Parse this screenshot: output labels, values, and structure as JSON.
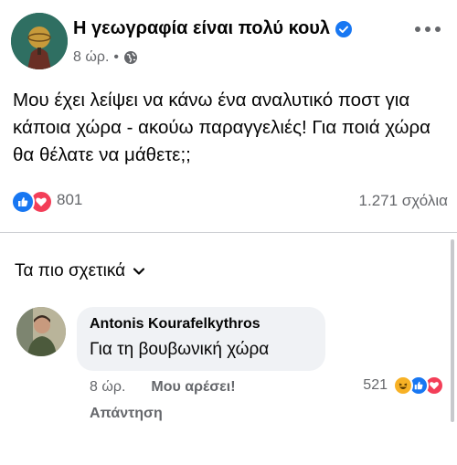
{
  "post": {
    "page_name": "Η γεωγραφία είναι πολύ κουλ",
    "time": "8 ώρ.",
    "text": "Μου έχει λείψει να κάνω ένα αναλυτικό ποστ για κάποια χώρα - ακούω παραγγελιές! Για ποιά χώρα θα θέλατε να μάθετε;;",
    "reaction_count": "801",
    "comments_count": "1.271 σχόλια",
    "verified_color": "#1877f2"
  },
  "comments": {
    "sort_label": "Τα πιο σχετικά"
  },
  "comment": {
    "author": "Antonis Kourafelkythros",
    "text": "Για τη βουβωνική χώρα",
    "time": "8 ώρ.",
    "like_label": "Μου αρέσει!",
    "reply_label": "Απάντηση",
    "reaction_count": "521"
  },
  "icons": {
    "like": "like-icon",
    "love": "love-icon",
    "haha": "haha-icon",
    "globe": "globe-icon",
    "verified": "verified-badge-icon",
    "more": "more-options-icon",
    "chevron": "chevron-down-icon"
  }
}
